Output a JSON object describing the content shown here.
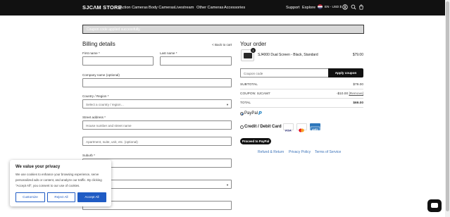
{
  "header": {
    "logo": "SJCΛM STORE",
    "nav": [
      "Action Cameras",
      "Body Cameras",
      "Livestream",
      "Other Cameras",
      "Accessories"
    ],
    "support": "Support",
    "explore": "Explore",
    "lang": "EN - USD $"
  },
  "notice": "Coupon code applied successfully.",
  "billing": {
    "title": "Billing details",
    "back": "< Back to cart",
    "first_name": "First name *",
    "last_name": "Last name *",
    "company": "Company name (optional)",
    "country": "Country / Region *",
    "country_placeholder": "Select a country / region…",
    "street": "Street address *",
    "street_placeholder": "House number and street name",
    "apt_placeholder": "Apartment, suite, unit, etc. (optional)",
    "suburb": "Suburb *"
  },
  "order": {
    "title": "Your order",
    "product": "SJ4000 Dual Screen - Black, Standard",
    "qty": "1",
    "price": "$79.00",
    "coupon_placeholder": "Coupon code",
    "apply": "Apply coupon",
    "subtotal_label": "SUBTOTAL",
    "subtotal": "$79.00",
    "coupon_label": "COUPON: SJCAM7",
    "coupon_value": "-$10.00",
    "remove": "[Remove]",
    "total_label": "TOTAL",
    "total": "$69.00",
    "paypal": "PayPal",
    "card": "Credit / Debit Card",
    "proceed": "Proceed to PayPal",
    "links": [
      "Refund & Return",
      "Privacy Policy",
      "Terms of Service"
    ]
  },
  "cookie": {
    "title": "We value your privacy",
    "text": "We use cookies to enhance your browsing experience, serve personalized ads or content, and analyze our traffic. By clicking \"Accept All\", you consent to our use of cookies.",
    "customize": "Customize",
    "reject": "Reject All",
    "accept": "Accept All"
  },
  "colors": {
    "header_bg": "#111111",
    "accent_blue": "#1f5bc4",
    "link_blue": "#3a72b8"
  }
}
